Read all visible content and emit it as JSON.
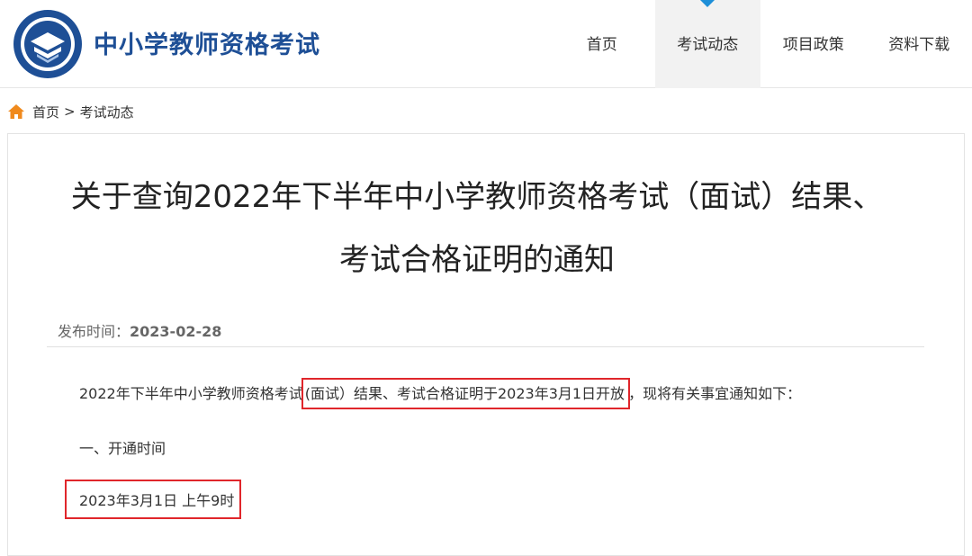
{
  "header": {
    "site_title": "中小学教师资格考试",
    "logo_icon": "teacher-certification-emblem",
    "brand_color": "#1e4f96"
  },
  "nav": {
    "items": [
      {
        "label": "首页"
      },
      {
        "label": "考试动态",
        "active": true
      },
      {
        "label": "项目政策"
      },
      {
        "label": "资料下载"
      }
    ],
    "active_indicator_color": "#1e8fd8"
  },
  "breadcrumb": {
    "icon": "home-icon",
    "home": "首页",
    "separator": ">",
    "current": "考试动态"
  },
  "article": {
    "title_line1": "关于查询2022年下半年中小学教师资格考试（面试）结果、",
    "title_line2": "考试合格证明的通知",
    "publish_label": "发布时间：",
    "publish_date": "2023-02-28",
    "para1_before": "2022年下半年中小学教师资格考试",
    "para1_highlight": "(面试）结果、考试合格证明于2023年3月1日开放",
    "para1_after": "，现将有关事宜通知如下：",
    "section1_heading": "一、开通时间",
    "section1_time": "2023年3月1日 上午9时",
    "highlight_color": "#e0262b"
  }
}
